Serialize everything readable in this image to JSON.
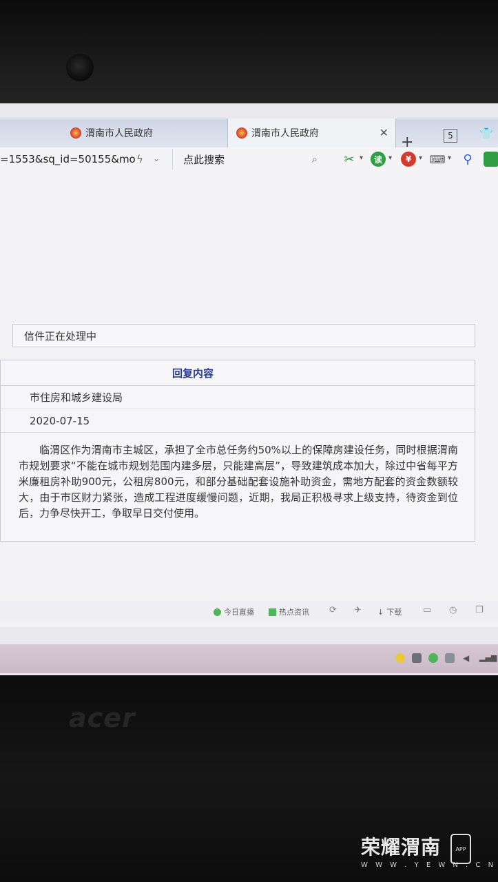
{
  "browser": {
    "tabs": [
      {
        "title": "渭南市人民政府",
        "active": false
      },
      {
        "title": "渭南市人民政府",
        "active": true
      }
    ],
    "tab_count": "5",
    "url": "=1553&sq_id=50155&mo",
    "search_label": "点此搜索",
    "toolbar_colors": {
      "scissors": "#2f9e44",
      "green": "#2f9e44",
      "red": "#d33a2c",
      "blue": "#2d5fd6"
    }
  },
  "page": {
    "status": "信件正在处理中",
    "reply": {
      "header": "回复内容",
      "department": "市住房和城乡建设局",
      "date": "2020-07-15",
      "body": "临渭区作为渭南市主城区，承担了全市总任务约50%以上的保障房建设任务，同时根据渭南市规划要求“不能在城市规划范围内建多层，只能建高层”，导致建筑成本加大，除过中省每平方米廉租房补助900元，公租房800元，和部分基础配套设施补助资金，需地方配套的资金数额较大，由于市区财力紧张，造成工程进度缓慢问题，近期，我局正积极寻求上级支持，待资金到位后，力争尽快开工，争取早日交付使用。"
    }
  },
  "statusbar": {
    "live": "今日直播",
    "news": "热点资讯",
    "download": "下载"
  },
  "laptop": {
    "brand": "acer"
  },
  "watermark": {
    "title": "荣耀渭南",
    "subtitle": "W W W . Y E W N . C N",
    "app": "APP"
  }
}
